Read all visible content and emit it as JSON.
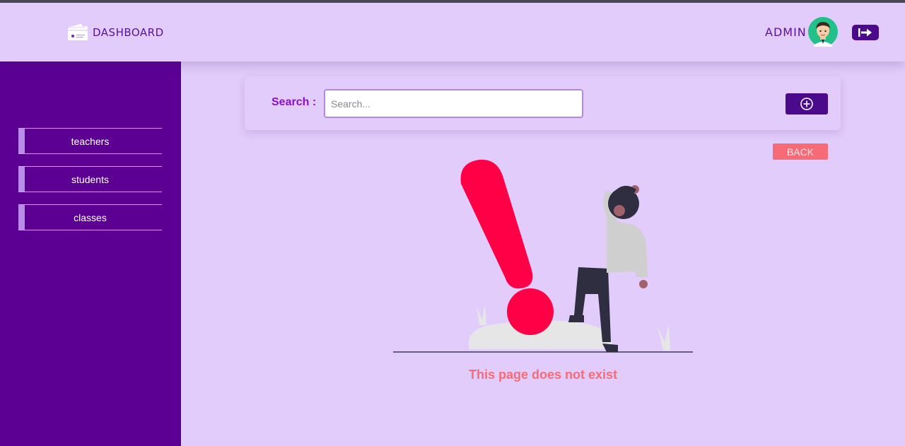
{
  "header": {
    "logo_text": "DASHBOARD",
    "user_name": "ADMIN"
  },
  "sidebar": {
    "items": [
      {
        "label": "teachers"
      },
      {
        "label": "students"
      },
      {
        "label": "classes"
      }
    ]
  },
  "search": {
    "label": "Search :",
    "placeholder": "Search..."
  },
  "content": {
    "back_label": "BACK",
    "message": "This page does not exist"
  },
  "colors": {
    "background": "#e2ccfb",
    "sidebar": "#5c0094",
    "accent_dark": "#4b0a8c",
    "label_purple": "#8a10cf",
    "back_button": "#f76b76",
    "error_text": "#f76b76",
    "exclamation": "#ff0047"
  },
  "icons": {
    "logo": "card-dashboard-icon",
    "avatar": "user-avatar-icon",
    "logout": "logout-arrow-icon",
    "add": "plus-circle-icon"
  }
}
